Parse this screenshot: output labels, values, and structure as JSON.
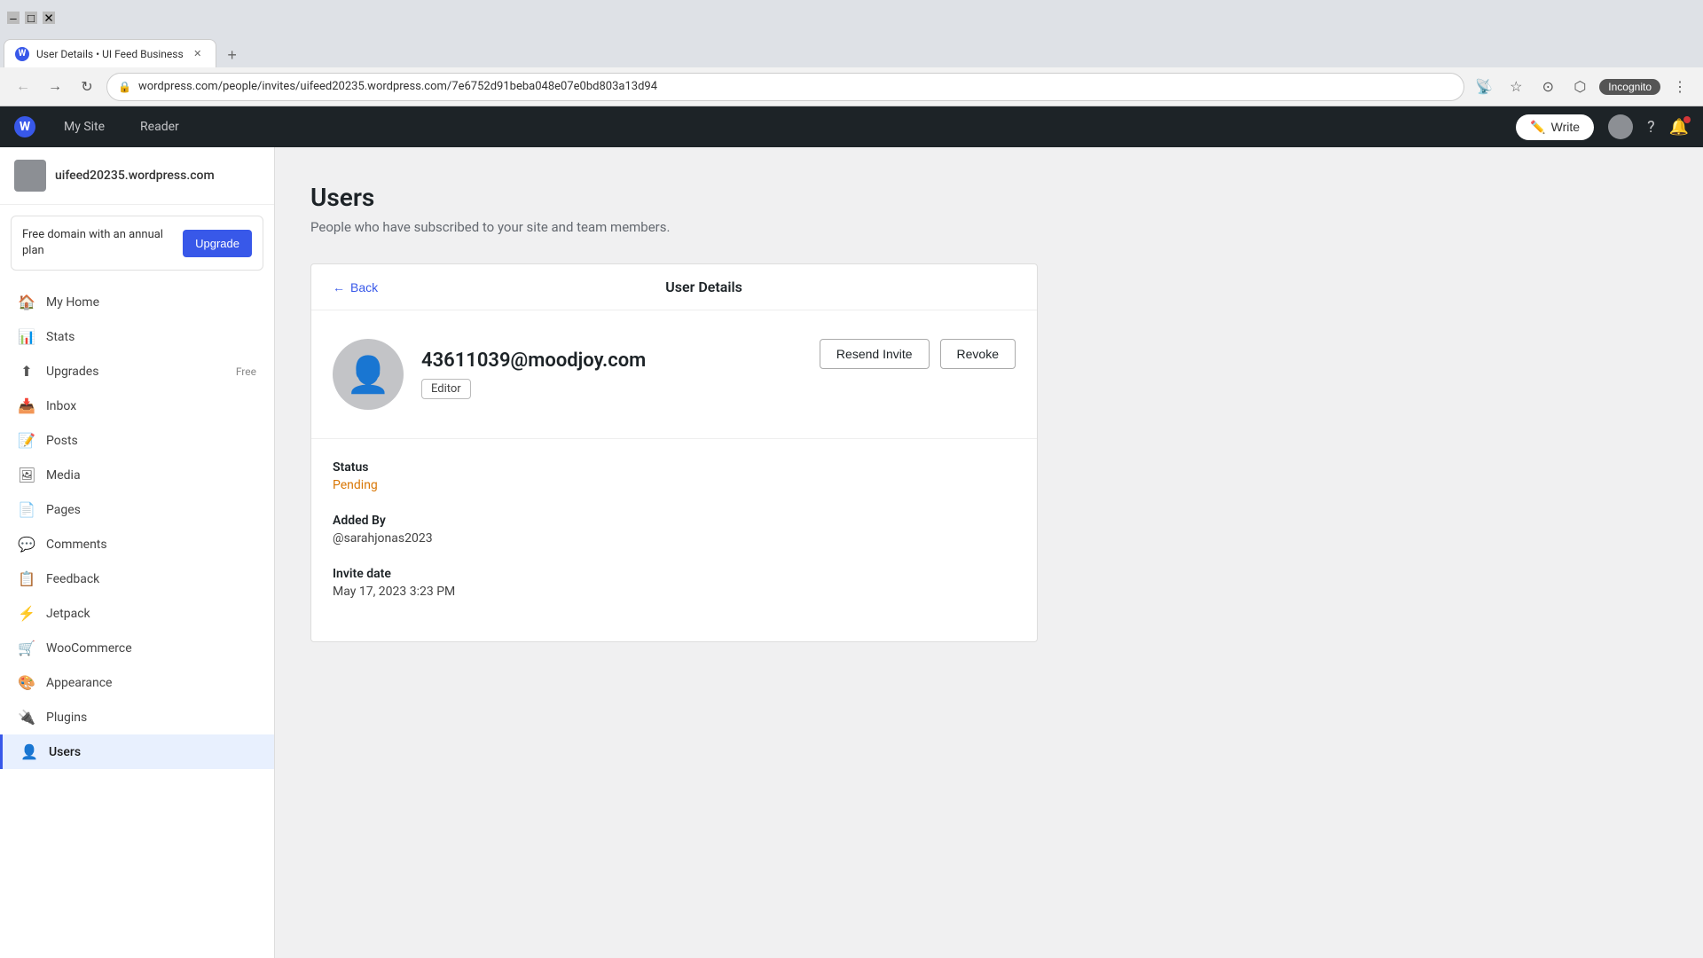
{
  "browser": {
    "tab_title": "User Details • UI Feed Business",
    "tab_favicon": "W",
    "address_url": "wordpress.com/people/invites/uifeed20235.wordpress.com/7e6752d91beba048e07e0bd803a13d94",
    "new_tab_label": "+",
    "nav_back_label": "←",
    "nav_forward_label": "→",
    "nav_refresh_label": "↻",
    "incognito_label": "Incognito"
  },
  "wp_navbar": {
    "logo_letter": "W",
    "my_site_label": "My Site",
    "reader_label": "Reader",
    "write_label": "Write",
    "incognito_label": "Incognito"
  },
  "sidebar": {
    "site_name": "uifeed20235.wordpress.com",
    "upgrade_banner": {
      "text": "Free domain with an annual plan",
      "button_label": "Upgrade"
    },
    "nav_items": [
      {
        "id": "my-home",
        "icon": "🏠",
        "label": "My Home",
        "badge": ""
      },
      {
        "id": "stats",
        "icon": "📊",
        "label": "Stats",
        "badge": ""
      },
      {
        "id": "upgrades",
        "icon": "⬆",
        "label": "Upgrades",
        "badge": "Free"
      },
      {
        "id": "inbox",
        "icon": "📥",
        "label": "Inbox",
        "badge": ""
      },
      {
        "id": "posts",
        "icon": "📝",
        "label": "Posts",
        "badge": ""
      },
      {
        "id": "media",
        "icon": "🖼",
        "label": "Media",
        "badge": ""
      },
      {
        "id": "pages",
        "icon": "📄",
        "label": "Pages",
        "badge": ""
      },
      {
        "id": "comments",
        "icon": "💬",
        "label": "Comments",
        "badge": ""
      },
      {
        "id": "feedback",
        "icon": "📋",
        "label": "Feedback",
        "badge": ""
      },
      {
        "id": "jetpack",
        "icon": "⚡",
        "label": "Jetpack",
        "badge": ""
      },
      {
        "id": "woocommerce",
        "icon": "🛒",
        "label": "WooCommerce",
        "badge": ""
      },
      {
        "id": "appearance",
        "icon": "🎨",
        "label": "Appearance",
        "badge": ""
      },
      {
        "id": "plugins",
        "icon": "🔌",
        "label": "Plugins",
        "badge": ""
      },
      {
        "id": "users",
        "icon": "👤",
        "label": "Users",
        "badge": "",
        "active": true
      }
    ]
  },
  "main": {
    "page_title": "Users",
    "page_subtitle": "People who have subscribed to your site and team members.",
    "card": {
      "back_label": "Back",
      "header_title": "User Details",
      "user_email": "43611039@moodjoy.com",
      "user_role": "Editor",
      "resend_invite_label": "Resend Invite",
      "revoke_label": "Revoke",
      "status_label": "Status",
      "status_value": "Pending",
      "added_by_label": "Added By",
      "added_by_value": "@sarahjonas2023",
      "invite_date_label": "Invite date",
      "invite_date_value": "May 17, 2023 3:23 PM"
    }
  }
}
